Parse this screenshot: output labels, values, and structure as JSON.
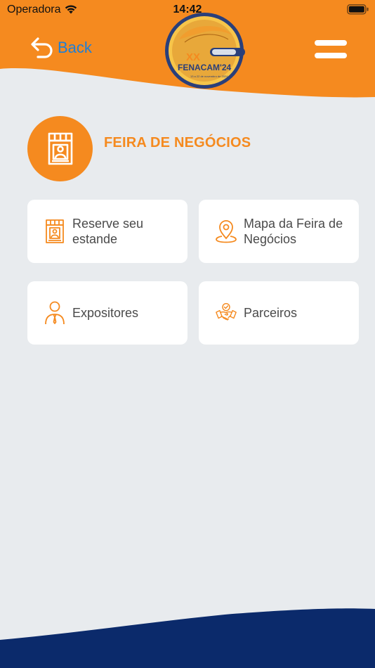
{
  "status_bar": {
    "carrier": "Operadora",
    "time": "14:42"
  },
  "header": {
    "back_label": "Back",
    "logo": {
      "line1": "XX",
      "line2": "FENACAM'24",
      "line3": "13 a 22 de novembro de 2024"
    },
    "menu_icon": "hamburger-icon"
  },
  "section": {
    "title": "FEIRA DE NEGÓCIOS",
    "icon": "booth-icon"
  },
  "cards": [
    {
      "label": "Reserve seu\nestande",
      "icon": "booth-icon"
    },
    {
      "label": "Mapa da Feira de\nNegócios",
      "icon": "map-pin-icon"
    },
    {
      "label": "Expositores",
      "icon": "person-icon"
    },
    {
      "label": "Parceiros",
      "icon": "handshake-icon"
    }
  ],
  "colors": {
    "primary_orange": "#f58a1f",
    "link_blue": "#1e7fd6",
    "footer_navy": "#0b2a6b",
    "background": "#e8ebee",
    "card_text": "#4a4a4a"
  }
}
